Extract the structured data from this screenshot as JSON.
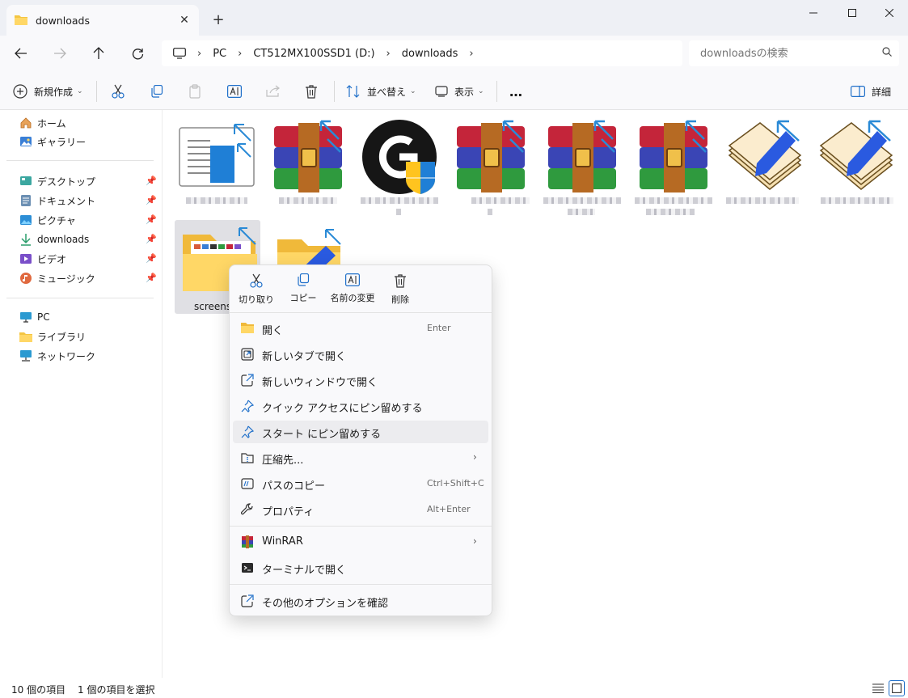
{
  "window": {
    "tab_title": "downloads",
    "tab_close": "✕",
    "new_tab": "+"
  },
  "address": {
    "crumbs": [
      "PC",
      "CT512MX100SSD1 (D:)",
      "downloads"
    ],
    "search_placeholder": "downloadsの検索"
  },
  "toolbar": {
    "new_label": "新規作成",
    "sort_label": "並べ替え",
    "view_label": "表示",
    "more_label": "…",
    "details_label": "詳細"
  },
  "sidebar": {
    "quick": [
      {
        "label": "ホーム",
        "icon": "home-icon"
      },
      {
        "label": "ギャラリー",
        "icon": "gallery-icon"
      }
    ],
    "pinned": [
      {
        "label": "デスクトップ",
        "icon": "desktop-icon"
      },
      {
        "label": "ドキュメント",
        "icon": "documents-icon"
      },
      {
        "label": "ピクチャ",
        "icon": "pictures-icon"
      },
      {
        "label": "downloads",
        "icon": "download-icon"
      },
      {
        "label": "ビデオ",
        "icon": "videos-icon"
      },
      {
        "label": "ミュージック",
        "icon": "music-icon"
      }
    ],
    "locations": [
      {
        "label": "PC",
        "icon": "pc-icon"
      },
      {
        "label": "ライブラリ",
        "icon": "library-icon"
      },
      {
        "label": "ネットワーク",
        "icon": "network-icon"
      }
    ]
  },
  "files": {
    "selected_name": "screensh"
  },
  "context_menu": {
    "quick_actions": [
      {
        "label": "切り取り",
        "icon": "cut-icon"
      },
      {
        "label": "コピー",
        "icon": "copy-icon"
      },
      {
        "label": "名前の変更",
        "icon": "rename-icon"
      },
      {
        "label": "削除",
        "icon": "delete-icon"
      }
    ],
    "items": [
      {
        "label": "開く",
        "shortcut": "Enter",
        "icon": "folder-open-icon"
      },
      {
        "label": "新しいタブで開く",
        "shortcut": "",
        "icon": "open-new-tab-icon"
      },
      {
        "label": "新しいウィンドウで開く",
        "shortcut": "",
        "icon": "open-new-window-icon"
      },
      {
        "label": "クイック アクセスにピン留めする",
        "shortcut": "",
        "icon": "pin-icon"
      },
      {
        "label": "スタート にピン留めする",
        "shortcut": "",
        "icon": "pin-icon"
      },
      {
        "label": "圧縮先...",
        "shortcut": "",
        "icon": "compress-icon"
      },
      {
        "label": "パスのコピー",
        "shortcut": "Ctrl+Shift+C",
        "icon": "copy-path-icon"
      },
      {
        "label": "プロパティ",
        "shortcut": "Alt+Enter",
        "icon": "wrench-icon"
      },
      {
        "label": "WinRAR",
        "shortcut": "",
        "icon": "winrar-icon"
      },
      {
        "label": "ターミナルで開く",
        "shortcut": "",
        "icon": "terminal-icon"
      },
      {
        "label": "その他のオプションを確認",
        "shortcut": "",
        "icon": "more-options-icon"
      }
    ]
  },
  "status": {
    "item_count": "10 個の項目",
    "selected_count": "1 個の項目を選択"
  }
}
